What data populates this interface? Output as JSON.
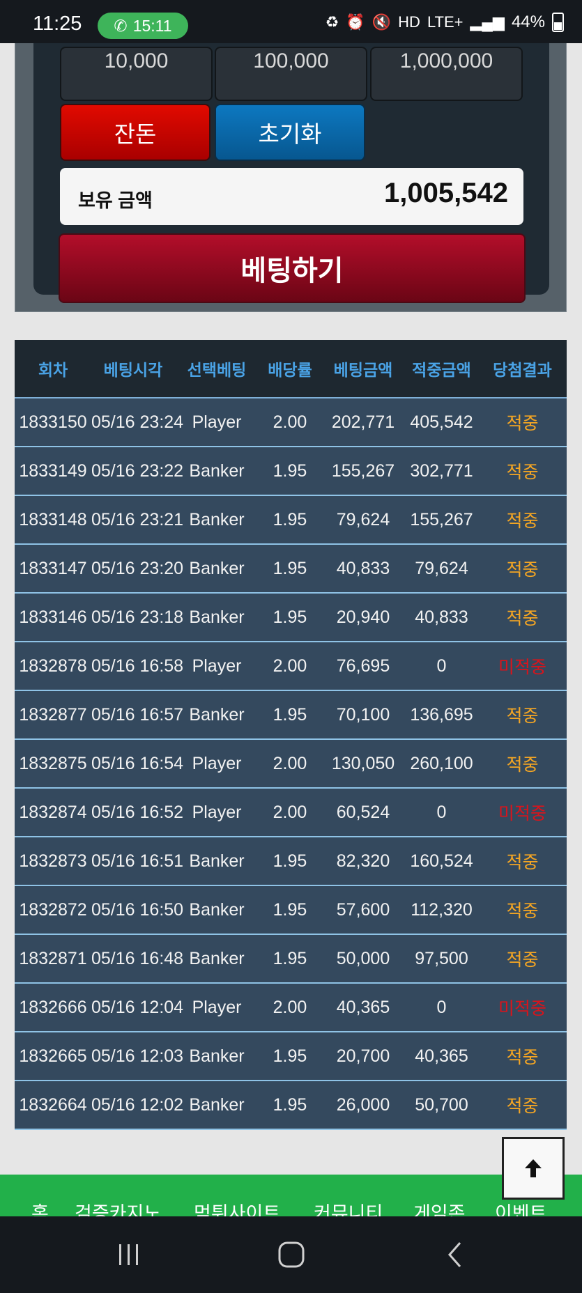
{
  "status_bar": {
    "time": "11:25",
    "call_timer": "15:11",
    "network": "LTE+",
    "battery": "44%"
  },
  "bet_panel": {
    "chips": [
      "10,000",
      "100,000",
      "1,000,000"
    ],
    "change_label": "잔돈",
    "reset_label": "초기화",
    "balance_label": "보유 금액",
    "balance_value": "1,005,542",
    "bet_button_label": "베팅하기"
  },
  "history_table": {
    "headers": [
      "회차",
      "베팅시각",
      "선택베팅",
      "배당률",
      "베팅금액",
      "적중금액",
      "당첨결과"
    ],
    "rows": [
      {
        "round": "1833150",
        "time": "05/16 23:24",
        "choice": "Player",
        "odds": "2.00",
        "bet": "202,771",
        "payout": "405,542",
        "result": "적중"
      },
      {
        "round": "1833149",
        "time": "05/16 23:22",
        "choice": "Banker",
        "odds": "1.95",
        "bet": "155,267",
        "payout": "302,771",
        "result": "적중"
      },
      {
        "round": "1833148",
        "time": "05/16 23:21",
        "choice": "Banker",
        "odds": "1.95",
        "bet": "79,624",
        "payout": "155,267",
        "result": "적중"
      },
      {
        "round": "1833147",
        "time": "05/16 23:20",
        "choice": "Banker",
        "odds": "1.95",
        "bet": "40,833",
        "payout": "79,624",
        "result": "적중"
      },
      {
        "round": "1833146",
        "time": "05/16 23:18",
        "choice": "Banker",
        "odds": "1.95",
        "bet": "20,940",
        "payout": "40,833",
        "result": "적중"
      },
      {
        "round": "1832878",
        "time": "05/16 16:58",
        "choice": "Player",
        "odds": "2.00",
        "bet": "76,695",
        "payout": "0",
        "result": "미적중"
      },
      {
        "round": "1832877",
        "time": "05/16 16:57",
        "choice": "Banker",
        "odds": "1.95",
        "bet": "70,100",
        "payout": "136,695",
        "result": "적중"
      },
      {
        "round": "1832875",
        "time": "05/16 16:54",
        "choice": "Player",
        "odds": "2.00",
        "bet": "130,050",
        "payout": "260,100",
        "result": "적중"
      },
      {
        "round": "1832874",
        "time": "05/16 16:52",
        "choice": "Player",
        "odds": "2.00",
        "bet": "60,524",
        "payout": "0",
        "result": "미적중"
      },
      {
        "round": "1832873",
        "time": "05/16 16:51",
        "choice": "Banker",
        "odds": "1.95",
        "bet": "82,320",
        "payout": "160,524",
        "result": "적중"
      },
      {
        "round": "1832872",
        "time": "05/16 16:50",
        "choice": "Banker",
        "odds": "1.95",
        "bet": "57,600",
        "payout": "112,320",
        "result": "적중"
      },
      {
        "round": "1832871",
        "time": "05/16 16:48",
        "choice": "Banker",
        "odds": "1.95",
        "bet": "50,000",
        "payout": "97,500",
        "result": "적중"
      },
      {
        "round": "1832666",
        "time": "05/16 12:04",
        "choice": "Player",
        "odds": "2.00",
        "bet": "40,365",
        "payout": "0",
        "result": "미적중"
      },
      {
        "round": "1832665",
        "time": "05/16 12:03",
        "choice": "Banker",
        "odds": "1.95",
        "bet": "20,700",
        "payout": "40,365",
        "result": "적중"
      },
      {
        "round": "1832664",
        "time": "05/16 12:02",
        "choice": "Banker",
        "odds": "1.95",
        "bet": "26,000",
        "payout": "50,700",
        "result": "적중"
      }
    ]
  },
  "bottom_nav": {
    "items": [
      "홈",
      "검증카지노",
      "먹튀사이트",
      "커뮤니티",
      "게임존",
      "이벤트"
    ]
  },
  "colors": {
    "win": "#f5a623",
    "lose": "#d8141c",
    "header_text": "#4aa3e6",
    "row_bg": "#34495e",
    "nav_green": "#22b04a"
  },
  "icons": {
    "scroll_top": "arrow-up-icon",
    "call": "phone-icon",
    "sys_recent": "recent-apps-icon",
    "sys_home": "home-icon",
    "sys_back": "back-icon"
  }
}
